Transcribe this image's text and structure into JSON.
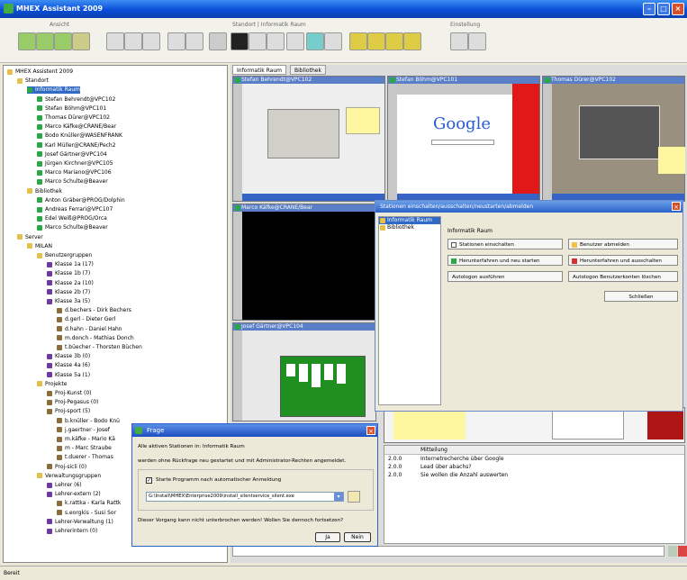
{
  "window": {
    "title": "MHEX Assistant 2009"
  },
  "toolbar": {
    "group1": "Ansicht",
    "group2": "Standort | Informatik Raum",
    "group3": "Einstellung"
  },
  "tree": {
    "items": [
      {
        "label": "MHEX Assistent 2009",
        "indent": 0,
        "icon": "folder"
      },
      {
        "label": "Standort",
        "indent": 1,
        "icon": "folder"
      },
      {
        "label": "Informatik Raum",
        "indent": 2,
        "icon": "pc",
        "selected": true
      },
      {
        "label": "Stefan Behrendt@VPC102",
        "indent": 3,
        "icon": "pc"
      },
      {
        "label": "Stefan Böhm@VPC101",
        "indent": 3,
        "icon": "pc"
      },
      {
        "label": "Thomas Dürer@VPC102",
        "indent": 3,
        "icon": "pc"
      },
      {
        "label": "Marco Käfke@CRANE/Bear",
        "indent": 3,
        "icon": "pc"
      },
      {
        "label": "Bodo Knüller@WASENFRANK",
        "indent": 3,
        "icon": "pc"
      },
      {
        "label": "Karl Müller@CRANE/Pech2",
        "indent": 3,
        "icon": "pc"
      },
      {
        "label": "Josef Gärtner@VPC104",
        "indent": 3,
        "icon": "pc"
      },
      {
        "label": "Jürgen Kirchner@VPC105",
        "indent": 3,
        "icon": "pc"
      },
      {
        "label": "Marco Mariano@VPC106",
        "indent": 3,
        "icon": "pc"
      },
      {
        "label": "Marco Schulte@Beaver",
        "indent": 3,
        "icon": "pc"
      },
      {
        "label": "Bibliothek",
        "indent": 2,
        "icon": "folder"
      },
      {
        "label": "Anton Gräber@PROG/Dolphin",
        "indent": 3,
        "icon": "pc"
      },
      {
        "label": "Andreas Ferrari@VPC107",
        "indent": 3,
        "icon": "pc"
      },
      {
        "label": "Edel Weiß@PROG/Orca",
        "indent": 3,
        "icon": "pc"
      },
      {
        "label": "Marco Schulte@Beaver",
        "indent": 3,
        "icon": "pc"
      },
      {
        "label": "Server",
        "indent": 1,
        "icon": "folder"
      },
      {
        "label": "MILAN",
        "indent": 2,
        "icon": "folder"
      },
      {
        "label": "Benutzergruppen",
        "indent": 3,
        "icon": "folder"
      },
      {
        "label": "Klasse 1a (17)",
        "indent": 4,
        "icon": "grp"
      },
      {
        "label": "Klasse 1b (7)",
        "indent": 4,
        "icon": "grp"
      },
      {
        "label": "Klasse 2a (10)",
        "indent": 4,
        "icon": "grp"
      },
      {
        "label": "Klasse 2b (7)",
        "indent": 4,
        "icon": "grp"
      },
      {
        "label": "Klasse 3a (5)",
        "indent": 4,
        "icon": "grp"
      },
      {
        "label": "d.bechers - Dirk Bechers",
        "indent": 5,
        "icon": "user"
      },
      {
        "label": "d.gerl - Dieter Gerl",
        "indent": 5,
        "icon": "user"
      },
      {
        "label": "d.hahn - Daniel Hahn",
        "indent": 5,
        "icon": "user"
      },
      {
        "label": "m.donch - Mathias Donch",
        "indent": 5,
        "icon": "user"
      },
      {
        "label": "t.büecher - Thorsten Büchen",
        "indent": 5,
        "icon": "user"
      },
      {
        "label": "Klasse 3b (0)",
        "indent": 4,
        "icon": "grp"
      },
      {
        "label": "Klasse 4a (6)",
        "indent": 4,
        "icon": "grp"
      },
      {
        "label": "Klasse 5a (1)",
        "indent": 4,
        "icon": "grp"
      },
      {
        "label": "Projekte",
        "indent": 3,
        "icon": "folder"
      },
      {
        "label": "Proj-Kunst (0)",
        "indent": 4,
        "icon": "user"
      },
      {
        "label": "Proj-Pegasus (0)",
        "indent": 4,
        "icon": "user"
      },
      {
        "label": "Proj-sport (5)",
        "indent": 4,
        "icon": "user"
      },
      {
        "label": "b.knüller - Bodo Knü",
        "indent": 5,
        "icon": "user"
      },
      {
        "label": "j.gaertner - Josef",
        "indent": 5,
        "icon": "user"
      },
      {
        "label": "m.käfke - Mario Kä",
        "indent": 5,
        "icon": "user"
      },
      {
        "label": "m - Marc Straube",
        "indent": 5,
        "icon": "user"
      },
      {
        "label": "t.duerer - Thomas",
        "indent": 5,
        "icon": "user"
      },
      {
        "label": "Proj-sicli (0)",
        "indent": 4,
        "icon": "user"
      },
      {
        "label": "Verwaltungsgruppen",
        "indent": 3,
        "icon": "folder"
      },
      {
        "label": "Lehrer (6)",
        "indent": 4,
        "icon": "grp"
      },
      {
        "label": "Lehrer-extern (2)",
        "indent": 4,
        "icon": "grp"
      },
      {
        "label": "k.rattka - Karla Rattk",
        "indent": 5,
        "icon": "user"
      },
      {
        "label": "s.eorgkis - Susi Sor",
        "indent": 5,
        "icon": "user"
      },
      {
        "label": "Lehrer-Verwaltung (1)",
        "indent": 4,
        "icon": "grp"
      },
      {
        "label": "Lehrerintern (0)",
        "indent": 4,
        "icon": "grp"
      }
    ]
  },
  "tabs": [
    "Informatik Raum",
    "Bibliothek"
  ],
  "monitors": [
    {
      "title": "Stefan Behrendt@VPC102"
    },
    {
      "title": "Stefan Böhm@VPC101"
    },
    {
      "title": "Thomas Dürer@VPC102"
    },
    {
      "title": "Marco Käfke@CRANE/Bear"
    },
    {
      "title": "Josef Gärtner@VPC104"
    }
  ],
  "google": "Google",
  "stations_dialog": {
    "title": "Stationen einschalten/ausschalten/neustarten/abmelden",
    "list": [
      "Informatik Raum",
      "Bibliothek"
    ],
    "section": "Informatik Raum",
    "buttons": {
      "on": "Stationen einschalten",
      "logoff": "Benutzer abmelden",
      "restart": "Herunterfahren und neu starten",
      "shutdown": "Herunterfahren und ausschalten",
      "autologon": "Autologon ausführen",
      "clear_autologon": "Autologon Benutzerkonten löschen",
      "close": "Schließen"
    }
  },
  "messages": {
    "header": "Mitteilung",
    "rows": [
      {
        "id": "2.0.0",
        "text": "Internetrecherche über Google"
      },
      {
        "id": "2.0.0",
        "text": "Lead über abachs?"
      },
      {
        "id": "2.0.0",
        "text": "Sie wollen die Anzahl auswerten"
      }
    ]
  },
  "frage_dialog": {
    "title": "Frage",
    "line1": "Alle aktiven Stationen in: Informatik Raum",
    "line2": "werden ohne Rückfrage neu gestartet und mit Administrator-Rechten angemeldet.",
    "checkbox": "Starte Programm nach automatischer Anmeldung",
    "path": "G:\\Install\\MHEX\\Enterprise2009\\install_silentservice_silent.exe",
    "line3": "Dieser Vorgang kann nicht unterbrochen werden! Wollen Sie dennoch fortsetzen?",
    "yes": "Ja",
    "no": "Nein"
  },
  "status": {
    "text": "Bereit"
  }
}
